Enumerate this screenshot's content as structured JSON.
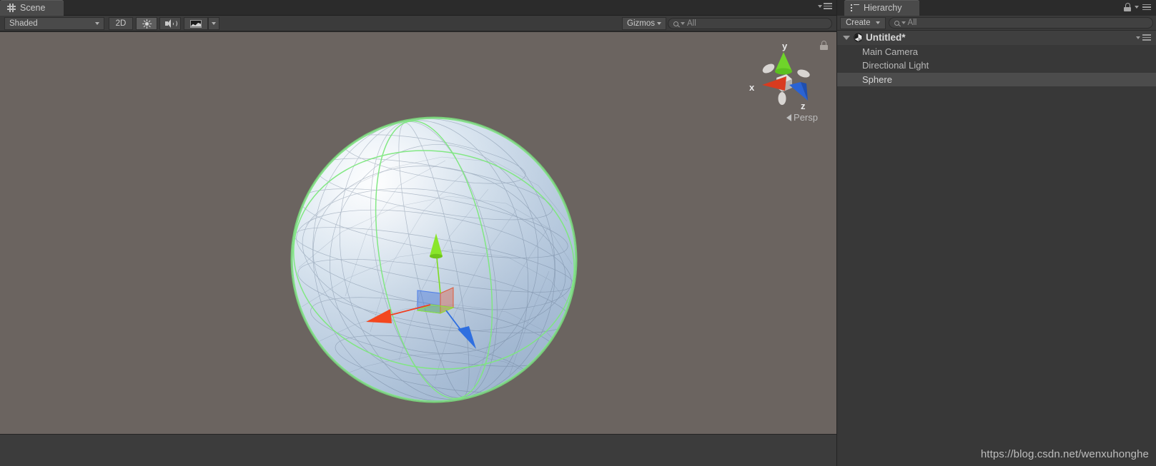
{
  "scene_panel": {
    "tab_label": "Scene",
    "tab_icon": "grid-icon",
    "toolbar": {
      "draw_mode": "Shaded",
      "mode_2d": "2D",
      "lighting_icon": "sun-icon",
      "audio_icon": "speaker-icon",
      "effects_icon": "image-icon",
      "gizmos_label": "Gizmos",
      "search_placeholder": "All",
      "search_value": "All",
      "search_icon": "search-icon"
    },
    "viewport": {
      "background_color": "#6b6460",
      "lock_icon": "lock-icon",
      "axis_gizmo": {
        "x_label": "x",
        "y_label": "y",
        "z_label": "z",
        "x_color": "#d93b1f",
        "y_color": "#6fd42a",
        "z_color": "#2a63d4",
        "projection_label": "Persp"
      },
      "selected_object": {
        "name": "Sphere",
        "outline_color": "#7ae87a",
        "gizmo": "move-gizmo",
        "gizmo_axis_x_color": "#ef4123",
        "gizmo_axis_y_color": "#7ddc20",
        "gizmo_axis_z_color": "#2f6fe0"
      }
    },
    "menu_icon": "hamburger-icon"
  },
  "hierarchy_panel": {
    "tab_label": "Hierarchy",
    "tab_icon": "list-icon",
    "lock_icon": "lock-icon",
    "menu_icon": "hamburger-icon",
    "toolbar": {
      "create_label": "Create",
      "search_placeholder": "All",
      "search_value": "All",
      "search_icon": "search-icon"
    },
    "scene_row": {
      "label": "Untitled*",
      "icon": "unity-scene-icon",
      "expanded": true,
      "menu_icon": "hamburger-icon"
    },
    "items": [
      {
        "label": "Main Camera",
        "selected": false
      },
      {
        "label": "Directional Light",
        "selected": false
      },
      {
        "label": "Sphere",
        "selected": true
      }
    ]
  },
  "watermark": {
    "text": "https://blog.csdn.net/wenxuhonghe"
  }
}
